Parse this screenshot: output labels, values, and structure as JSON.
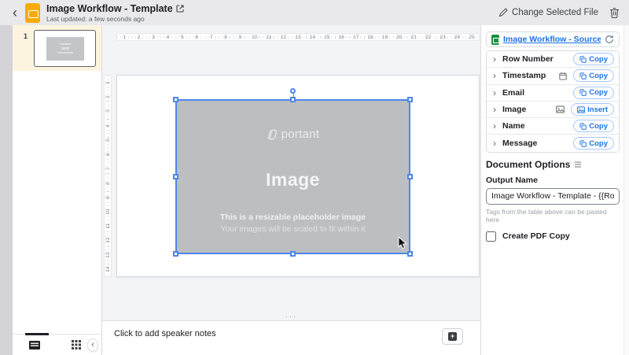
{
  "header": {
    "back_label": "‹",
    "title": "Image Workflow - Template",
    "subtitle": "Last updated: a few seconds ago",
    "change_file_label": "Change Selected File"
  },
  "filmstrip": {
    "slide_number": "1"
  },
  "rulers": {
    "horizontal": [
      "1",
      "2",
      "3",
      "4",
      "5",
      "6",
      "7",
      "8",
      "9",
      "10",
      "11",
      "12",
      "13",
      "14",
      "15",
      "16",
      "17",
      "18",
      "19",
      "20",
      "21",
      "22",
      "23",
      "24",
      "25"
    ],
    "vertical": [
      "1",
      "2",
      "3",
      "4",
      "5",
      "6",
      "7",
      "8",
      "9",
      "10",
      "11",
      "12",
      "13",
      "14"
    ]
  },
  "slide": {
    "logo_text": "portant",
    "placeholder_title": "Image",
    "caption_line1": "This is a resizable placeholder image",
    "caption_line2": "Your images will be scaled to fit within it"
  },
  "notes": {
    "placeholder": "Click to add speaker notes",
    "resize_dots": "···",
    "add_button_glyph": "+"
  },
  "source": {
    "link_label": "Image Workflow - Source"
  },
  "fields": [
    {
      "label": "Row Number",
      "action": "Copy"
    },
    {
      "label": "Timestamp",
      "action": "Copy",
      "icon": "calendar"
    },
    {
      "label": "Email",
      "action": "Copy"
    },
    {
      "label": "Image",
      "action": "Insert",
      "icon": "image"
    },
    {
      "label": "Name",
      "action": "Copy"
    },
    {
      "label": "Message",
      "action": "Copy"
    }
  ],
  "document_options": {
    "heading": "Document Options",
    "output_name_label": "Output Name",
    "output_name_value": "Image Workflow - Template - {{Row Number}}",
    "helper_text": "Tags from the table above can be pasted here",
    "pdf_label": "Create PDF Copy"
  },
  "colors": {
    "accent_blue": "#1a73e8",
    "selection_blue": "#4e86ec",
    "slides_yellow": "#f9ab00",
    "sheets_green": "#1e8e3e",
    "placeholder_gray": "#bcbfc2",
    "selected_slide_cream": "#fcf4df"
  }
}
